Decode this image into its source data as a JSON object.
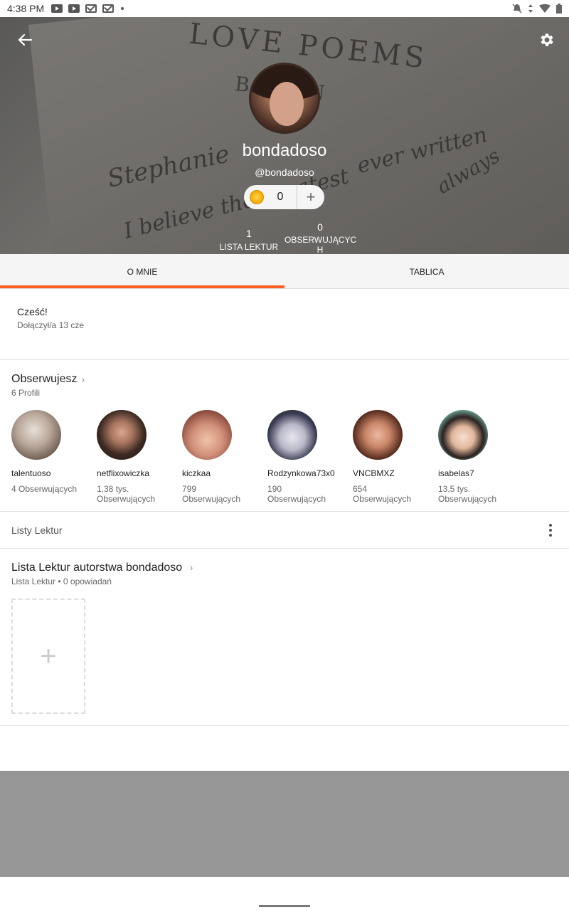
{
  "status_bar": {
    "time": "4:38 PM",
    "icons": [
      "youtube-icon",
      "youtube-icon",
      "gmail-icon",
      "gmail-icon",
      "dot-icon",
      "mute-icon",
      "data-icon",
      "wifi-icon",
      "battery-icon"
    ]
  },
  "header": {
    "username": "bondadoso",
    "handle": "@bondadoso",
    "coins": "0",
    "background_text": {
      "title": "LOVE POEMS",
      "subtitle": "B      MEN",
      "script_line1": "Stephanie",
      "script_line2": "I believe the greatest",
      "script_line3": "ever written",
      "script_line4": "always"
    },
    "stats": {
      "reading_lists_count": "1",
      "reading_lists_label": "LISTA LEKTUR",
      "followers_count": "0",
      "followers_label": "OBSERWUJĄCYC\nH"
    }
  },
  "tabs": [
    {
      "label": "O MNIE",
      "active": true
    },
    {
      "label": "TABLICA",
      "active": false
    }
  ],
  "about": {
    "greeting": "Cześć!",
    "joined": "Dołączył/a 13 cze"
  },
  "following": {
    "title": "Obserwujesz",
    "subtitle": "6 Profili",
    "profiles": [
      {
        "name": "talentuoso",
        "followers": "4 Obserwujących"
      },
      {
        "name": "netflixowiczka",
        "followers": "1,38 tys. Obserwujących"
      },
      {
        "name": "kiczkaa",
        "followers": "799 Obserwujących"
      },
      {
        "name": "Rodzynkowa73x0",
        "followers": "190 Obserwujących"
      },
      {
        "name": "VNCBMXZ",
        "followers": "654 Obserwujących"
      },
      {
        "name": "isabelas7",
        "followers": "13,5 tys. Obserwujących"
      }
    ]
  },
  "reading_lists": {
    "section_label": "Listy Lektur",
    "list_title": "Lista Lektur autorstwa bondadoso",
    "list_meta": "Lista Lektur • 0 opowiadań"
  },
  "colors": {
    "accent": "#ff6122",
    "divider": "#e2e2e2",
    "tab_bg": "#f5f5f5"
  }
}
